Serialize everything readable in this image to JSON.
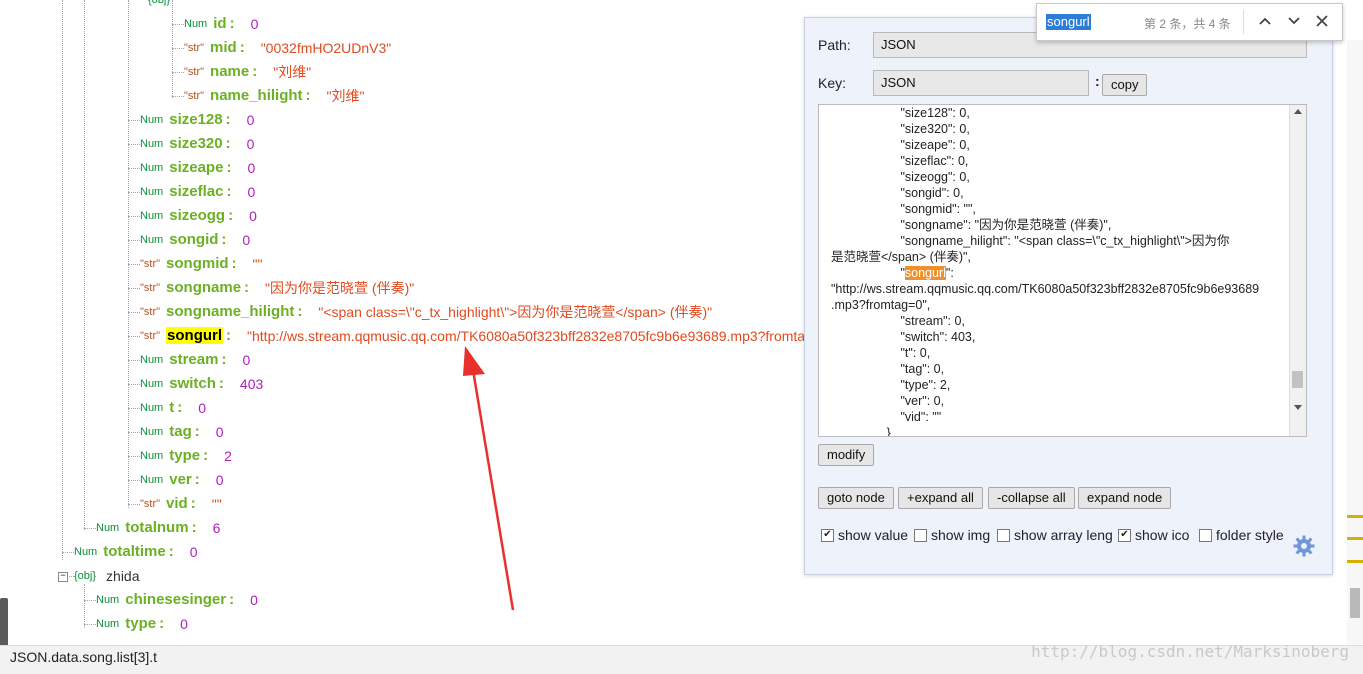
{
  "tree": {
    "rows": [
      {
        "type": "Num",
        "key": "id",
        "value": "0",
        "vtype": "num"
      },
      {
        "type": "\"str\"",
        "key": "mid",
        "value": "\"0032fmHO2UDnV3\"",
        "vtype": "str"
      },
      {
        "type": "\"str\"",
        "key": "name",
        "value": "\"刘维\"",
        "vtype": "str"
      },
      {
        "type": "\"str\"",
        "key": "name_hilight",
        "value": "\"刘维\"",
        "vtype": "str"
      },
      {
        "type": "Num",
        "key": "size128",
        "value": "0",
        "vtype": "num"
      },
      {
        "type": "Num",
        "key": "size320",
        "value": "0",
        "vtype": "num"
      },
      {
        "type": "Num",
        "key": "sizeape",
        "value": "0",
        "vtype": "num"
      },
      {
        "type": "Num",
        "key": "sizeflac",
        "value": "0",
        "vtype": "num"
      },
      {
        "type": "Num",
        "key": "sizeogg",
        "value": "0",
        "vtype": "num"
      },
      {
        "type": "Num",
        "key": "songid",
        "value": "0",
        "vtype": "num"
      },
      {
        "type": "\"str\"",
        "key": "songmid",
        "value": "\"\"",
        "vtype": "str"
      },
      {
        "type": "\"str\"",
        "key": "songname",
        "value": "\"因为你是范晓萱 (伴奏)\"",
        "vtype": "str"
      },
      {
        "type": "\"str\"",
        "key": "songname_hilight",
        "value": "\"<span class=\\\"c_tx_highlight\\\">因为你是范晓萱</span> (伴奏)\"",
        "vtype": "str"
      },
      {
        "type": "\"str\"",
        "key": "songurl",
        "value": "\"http://ws.stream.qqmusic.qq.com/TK6080a50f323bff2832e8705fc9b6e93689.mp3?fromtag=0\"",
        "vtype": "str"
      },
      {
        "type": "Num",
        "key": "stream",
        "value": "0",
        "vtype": "num"
      },
      {
        "type": "Num",
        "key": "switch",
        "value": "403",
        "vtype": "num"
      },
      {
        "type": "Num",
        "key": "t",
        "value": "0",
        "vtype": "num"
      },
      {
        "type": "Num",
        "key": "tag",
        "value": "0",
        "vtype": "num"
      },
      {
        "type": "Num",
        "key": "type",
        "value": "2",
        "vtype": "num"
      },
      {
        "type": "Num",
        "key": "ver",
        "value": "0",
        "vtype": "num"
      },
      {
        "type": "\"str\"",
        "key": "vid",
        "value": "\"\"",
        "vtype": "str"
      },
      {
        "type": "Num",
        "key": "totalnum",
        "value": "6",
        "vtype": "num"
      },
      {
        "type": "Num",
        "key": "totaltime",
        "value": "0",
        "vtype": "num"
      },
      {
        "type": "{obj}",
        "key": "zhida",
        "value": "",
        "vtype": "obj"
      },
      {
        "type": "Num",
        "key": "chinesesinger",
        "value": "0",
        "vtype": "num"
      },
      {
        "type": "Num",
        "key": "type",
        "value": "0",
        "vtype": "num"
      }
    ],
    "top_obj_label": "{obj}"
  },
  "panel": {
    "path_label": "Path:",
    "path_value": "JSON",
    "key_label": "Key:",
    "key_value": "JSON",
    "key_colon": ":",
    "copy_label": "copy",
    "json_lines": [
      "                    \"size128\": 0,",
      "                    \"size320\": 0,",
      "                    \"sizeape\": 0,",
      "                    \"sizeflac\": 0,",
      "                    \"sizeogg\": 0,",
      "                    \"songid\": 0,",
      "                    \"songmid\": \"\",",
      "                    \"songname\": \"因为你是范晓萱 (伴奏)\",",
      "                    \"songname_hilight\": \"<span class=\\\"c_tx_highlight\\\">因为你",
      "是范晓萱</span> (伴奏)\","
    ],
    "json_songurl_prefix": "                    \"",
    "json_songurl_key": "songurl",
    "json_songurl_suffix": "\":",
    "json_lines_after": [
      "\"http://ws.stream.qqmusic.qq.com/TK6080a50f323bff2832e8705fc9b6e93689",
      ".mp3?fromtag=0\",",
      "                    \"stream\": 0,",
      "                    \"switch\": 403,",
      "                    \"t\": 0,",
      "                    \"tag\": 0,",
      "                    \"type\": 2,",
      "                    \"ver\": 0,",
      "                    \"vid\": \"\"",
      "                }"
    ],
    "modify_label": "modify",
    "goto_label": "goto node",
    "expand_all_label": "+expand all",
    "collapse_all_label": "-collapse all",
    "expand_node_label": "expand node",
    "checkboxes": [
      {
        "label": "show value",
        "checked": true
      },
      {
        "label": "show img",
        "checked": false
      },
      {
        "label": "show array leng",
        "checked": false
      },
      {
        "label": "show ico",
        "checked": true
      },
      {
        "label": "folder style",
        "checked": false
      }
    ]
  },
  "findbar": {
    "query": "songurl",
    "count": "第 2 条，共 4 条"
  },
  "status": {
    "path": "JSON.data.song.list[3].t"
  },
  "watermark": "http://blog.csdn.net/Marksinoberg",
  "colors": {
    "key_green": "#6cb024",
    "num_purple": "#b01ec0",
    "str_red": "#e24a1e",
    "highlight_yellow": "#ffff00",
    "highlight_orange": "#f0902a",
    "arrow_red": "#e8302c"
  }
}
